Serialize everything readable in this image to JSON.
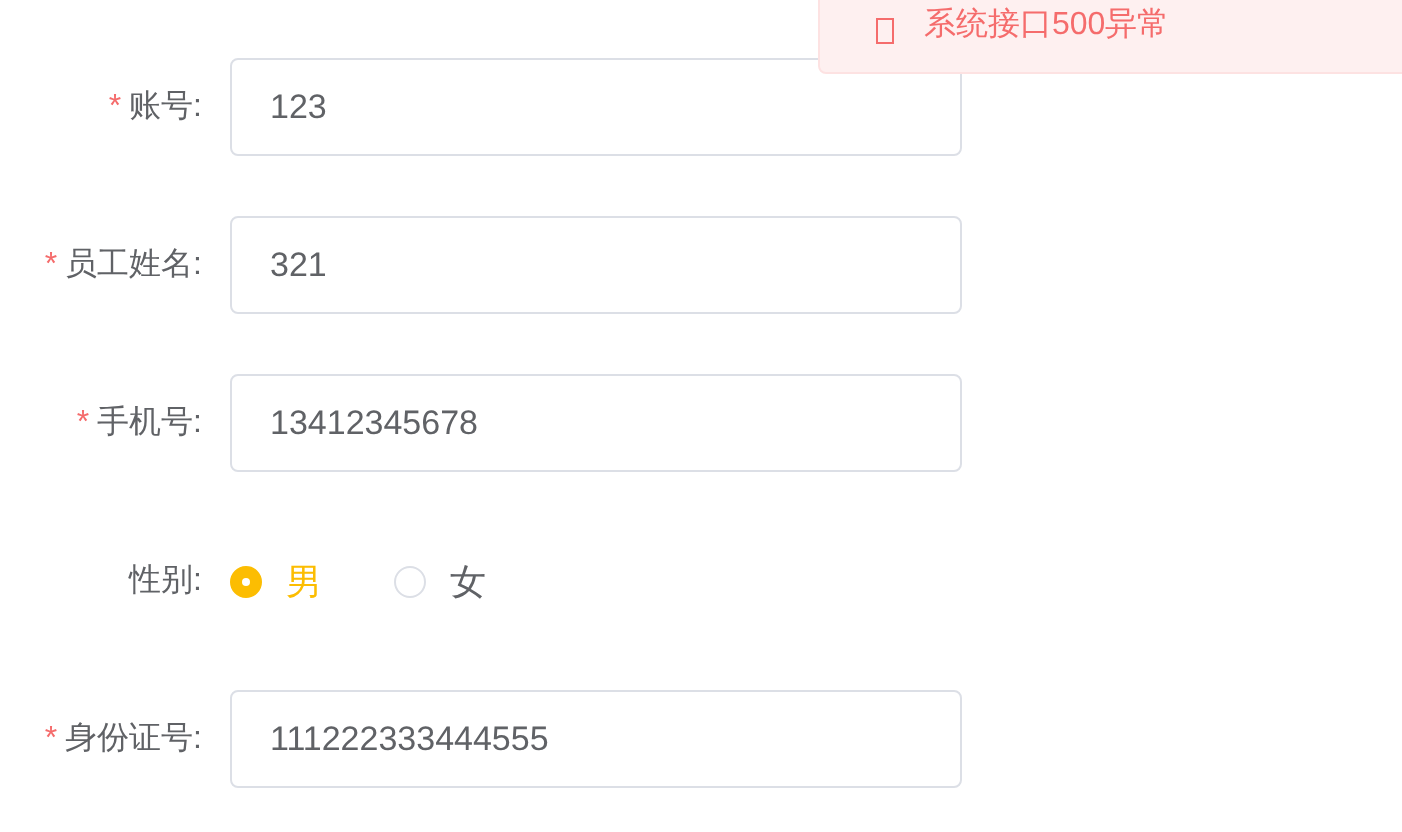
{
  "message": {
    "text": "系统接口500异常"
  },
  "form": {
    "fields": [
      {
        "kind": "input",
        "required_mark": "*",
        "label": "账号:",
        "value": "123"
      },
      {
        "kind": "input",
        "required_mark": "*",
        "label": "员工姓名:",
        "value": "321"
      },
      {
        "kind": "input",
        "required_mark": "*",
        "label": "手机号:",
        "value": "13412345678"
      },
      {
        "kind": "radio",
        "label": "性别:",
        "options": [
          {
            "label": "男",
            "selected": true
          },
          {
            "label": "女",
            "selected": false
          }
        ]
      },
      {
        "kind": "input",
        "required_mark": "*",
        "label": "身份证号:",
        "value": "111222333444555"
      }
    ]
  }
}
